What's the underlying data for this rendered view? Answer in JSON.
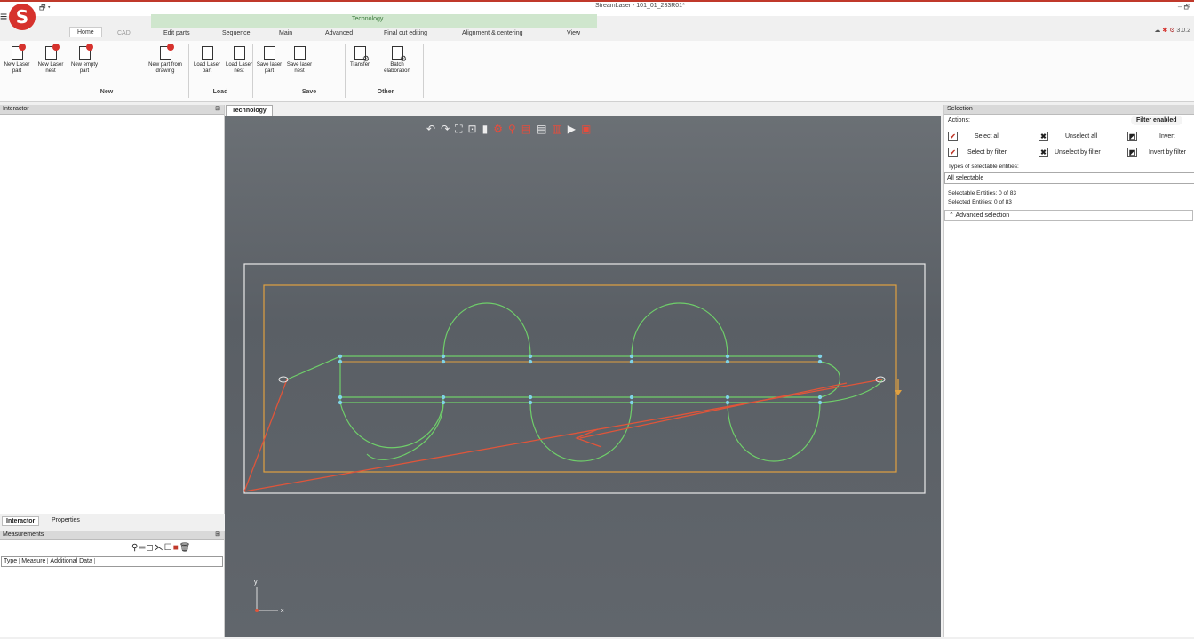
{
  "window": {
    "title": "StreamLaser - 101_01_233R01*",
    "controls": "–  🗗",
    "version": "3.0.2"
  },
  "logo": {
    "letter": "S"
  },
  "context_group": "Technology",
  "tabs": [
    "Home",
    "CAD",
    "Edit parts",
    "Sequence",
    "Main",
    "Advanced",
    "Final cut editing",
    "Alignment & centering",
    "View"
  ],
  "ribbon": {
    "buttons": [
      {
        "label": "New Laser part"
      },
      {
        "label": "New Laser nest"
      },
      {
        "label": "New empty part"
      },
      {
        "label": "New part from drawing"
      },
      {
        "label": "Load Laser part"
      },
      {
        "label": "Load Laser nest"
      },
      {
        "label": "Save laser part"
      },
      {
        "label": "Save laser nest"
      },
      {
        "label": "Transfer"
      },
      {
        "label": "Batch elaboration"
      }
    ],
    "groups": [
      "New",
      "Load",
      "Save",
      "Other"
    ]
  },
  "panels": {
    "interactor_title": "Interactor",
    "bottom_tabs": [
      "Interactor",
      "Properties"
    ],
    "measurements_title": "Measurements",
    "measurement_columns": [
      "Type",
      "Measure",
      "Additional Data"
    ]
  },
  "viewport": {
    "tab": "Technology",
    "axis_x": "x",
    "axis_y": "y"
  },
  "selection": {
    "title": "Selection",
    "actions_label": "Actions:",
    "filter_label": "Filter enabled",
    "buttons": [
      "Select all",
      "Unselect all",
      "Invert",
      "Select by filter",
      "Unselect by filter",
      "Invert by filter"
    ],
    "types_label": "Types of selectable entities:",
    "types_value": "All selectable",
    "selectable_count": "Selectable Entities: 0 of 83",
    "selected_count": "Selected   Entities: 0 of 83",
    "advanced": "Advanced selection"
  },
  "colors": {
    "accent": "#d6322d",
    "context": "#cfe6cd",
    "path_green": "#6fcf6a",
    "path_orange": "#e0a040",
    "path_red": "#e0553a",
    "node": "#7fd3e6"
  }
}
